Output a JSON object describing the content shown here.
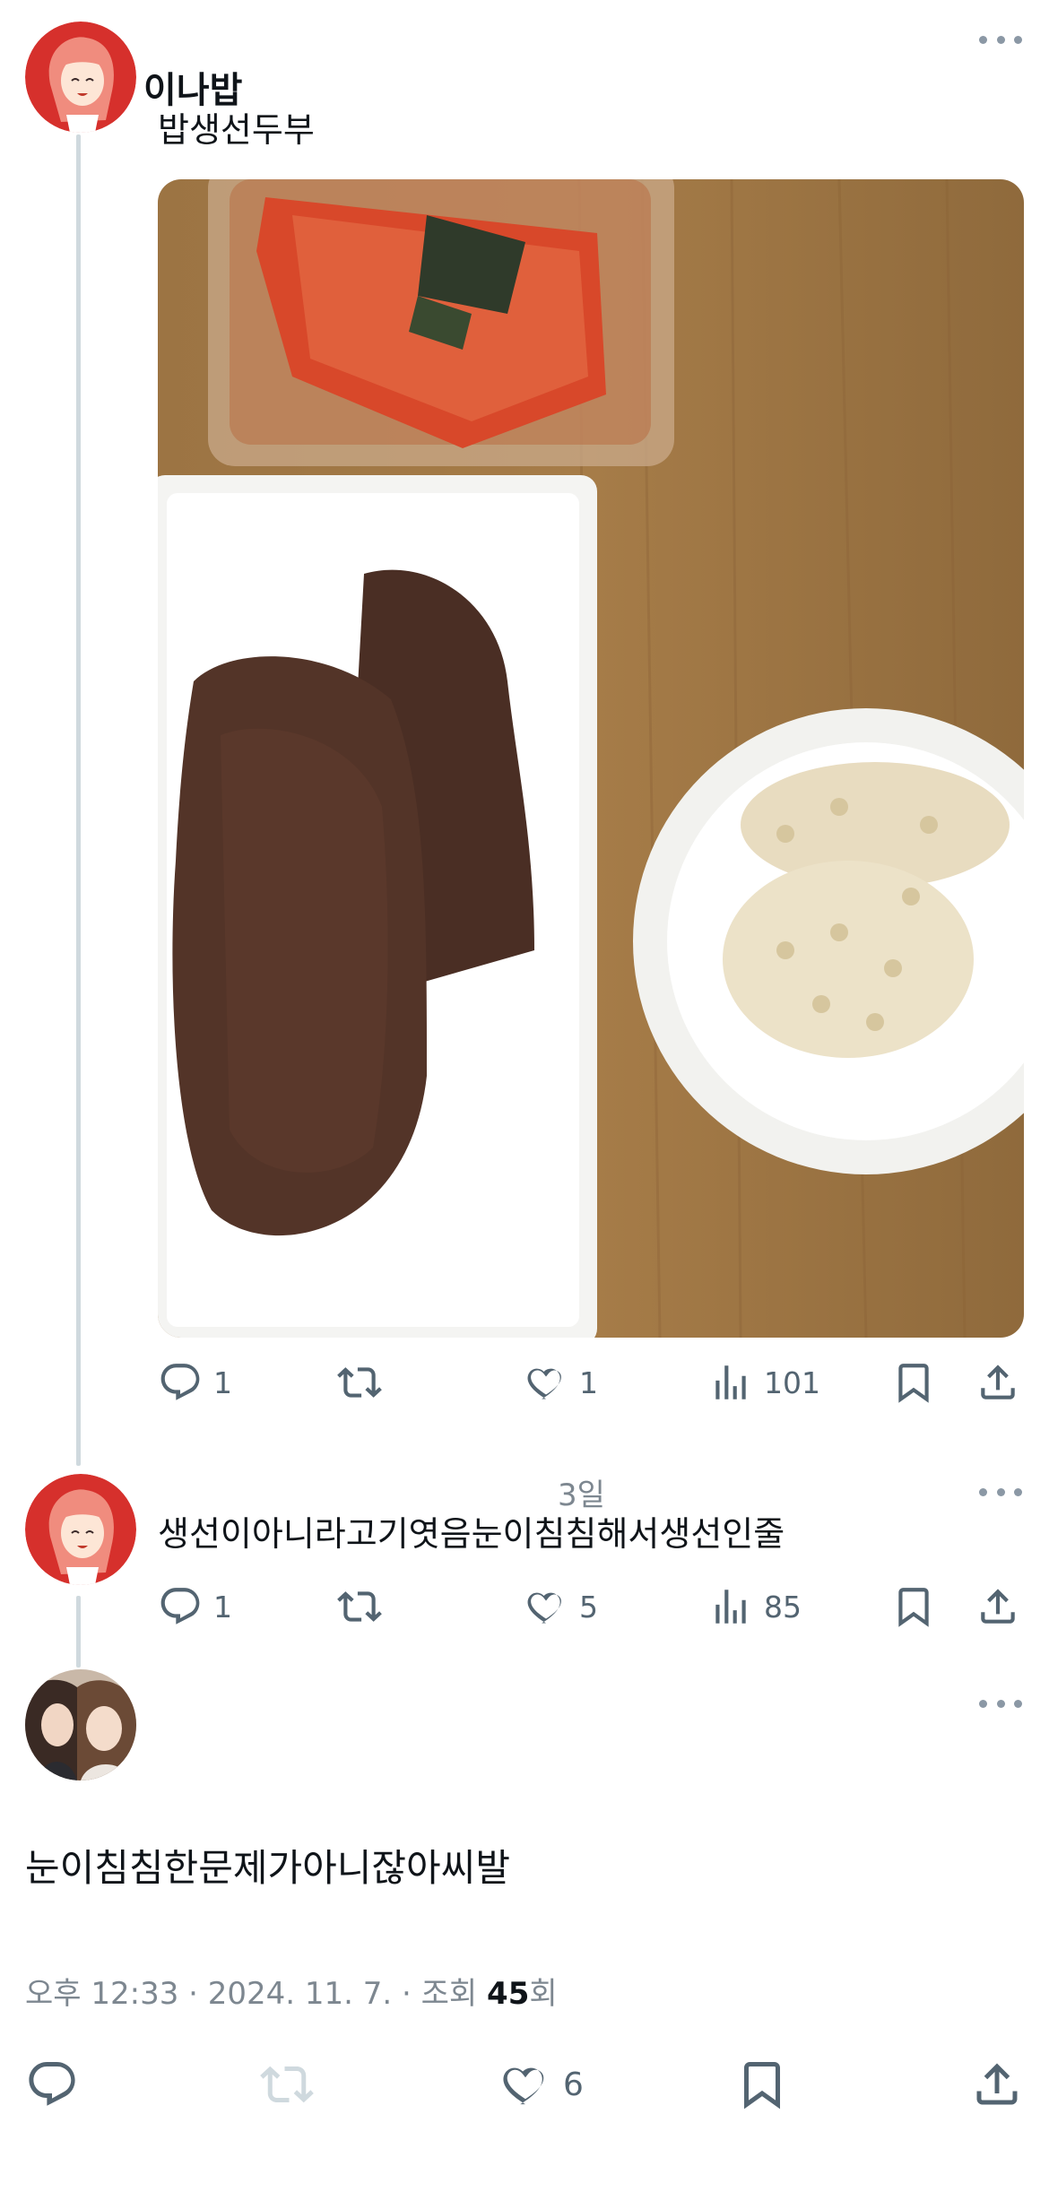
{
  "post1": {
    "author_name": "이나밥",
    "text": "밥생선두부",
    "stats": {
      "replies": "1",
      "retweets": "",
      "likes": "1",
      "views": "101"
    }
  },
  "post2": {
    "time": "3일",
    "text": "생선이아니라고기엿음눈이침침해서생선인줄",
    "stats": {
      "replies": "1",
      "retweets": "",
      "likes": "5",
      "views": "85"
    }
  },
  "main": {
    "text": "눈이침침한문제가아니잖아씨발",
    "meta_prefix": "오후 12:33 · 2024. 11. 7. · 조회 ",
    "views": "45",
    "meta_suffix": "회",
    "stats": {
      "likes": "6"
    }
  },
  "colors": {
    "icon": "#536471",
    "thread": "#cfd9de",
    "avatar_red": "#d6302c"
  },
  "icons": [
    "reply-icon",
    "retweet-icon",
    "like-icon",
    "views-icon",
    "bookmark-icon",
    "share-icon",
    "more-icon"
  ]
}
